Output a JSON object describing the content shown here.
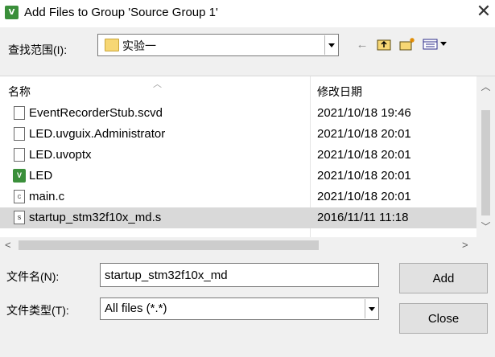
{
  "window": {
    "title": "Add Files to Group 'Source Group 1'",
    "close_glyph": "✕"
  },
  "look_in": {
    "label": "查找范围(I):",
    "value": "实验一"
  },
  "toolbar": {
    "back_glyph": "←",
    "up_folder_glyph": "⇪",
    "new_folder_glyph": "✱",
    "view_menu_glyph": "▦▾"
  },
  "file_list": {
    "columns": [
      "名称",
      "修改日期"
    ],
    "selected_index": 5,
    "rows": [
      {
        "name": "EventRecorderStub.scvd",
        "date": "2021/10/18 19:46",
        "icon": "document-icon"
      },
      {
        "name": "LED.uvguix.Administrator",
        "date": "2021/10/18 20:01",
        "icon": "document-icon"
      },
      {
        "name": "LED.uvoptx",
        "date": "2021/10/18 20:01",
        "icon": "document-icon"
      },
      {
        "name": "LED",
        "date": "2021/10/18 20:01",
        "icon": "uvision-project-icon"
      },
      {
        "name": "main.c",
        "date": "2021/10/18 20:01",
        "icon": "c-source-icon"
      },
      {
        "name": "startup_stm32f10x_md.s",
        "date": "2016/11/11 11:18",
        "icon": "assembly-file-icon"
      }
    ]
  },
  "file_name": {
    "label": "文件名(N):",
    "value": "startup_stm32f10x_md"
  },
  "file_type": {
    "label": "文件类型(T):",
    "value": "All files (*.*)"
  },
  "buttons": {
    "add": "Add",
    "close": "Close"
  },
  "colors": {
    "dialog_bg": "#f0f0f0",
    "selection": "#d9d9d9",
    "uvision_green": "#3a8f3a"
  }
}
